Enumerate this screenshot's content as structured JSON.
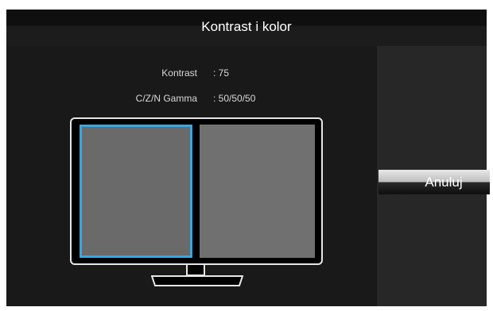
{
  "dialog": {
    "title": "Kontrast i kolor"
  },
  "settings": [
    {
      "label": "Kontrast",
      "value": ": 75"
    },
    {
      "label": "C/Z/N Gamma",
      "value": ": 50/50/50"
    }
  ],
  "buttons": {
    "cancel_label": "Anuluj"
  },
  "preview": {
    "selected_panel": "left",
    "selection_color": "#39a6e0",
    "left_panel_color": "#6a6a6a",
    "right_panel_color": "#707070"
  },
  "colors": {
    "background": "#141414",
    "title_text": "#ffffff",
    "sidepanel": "#272727"
  }
}
